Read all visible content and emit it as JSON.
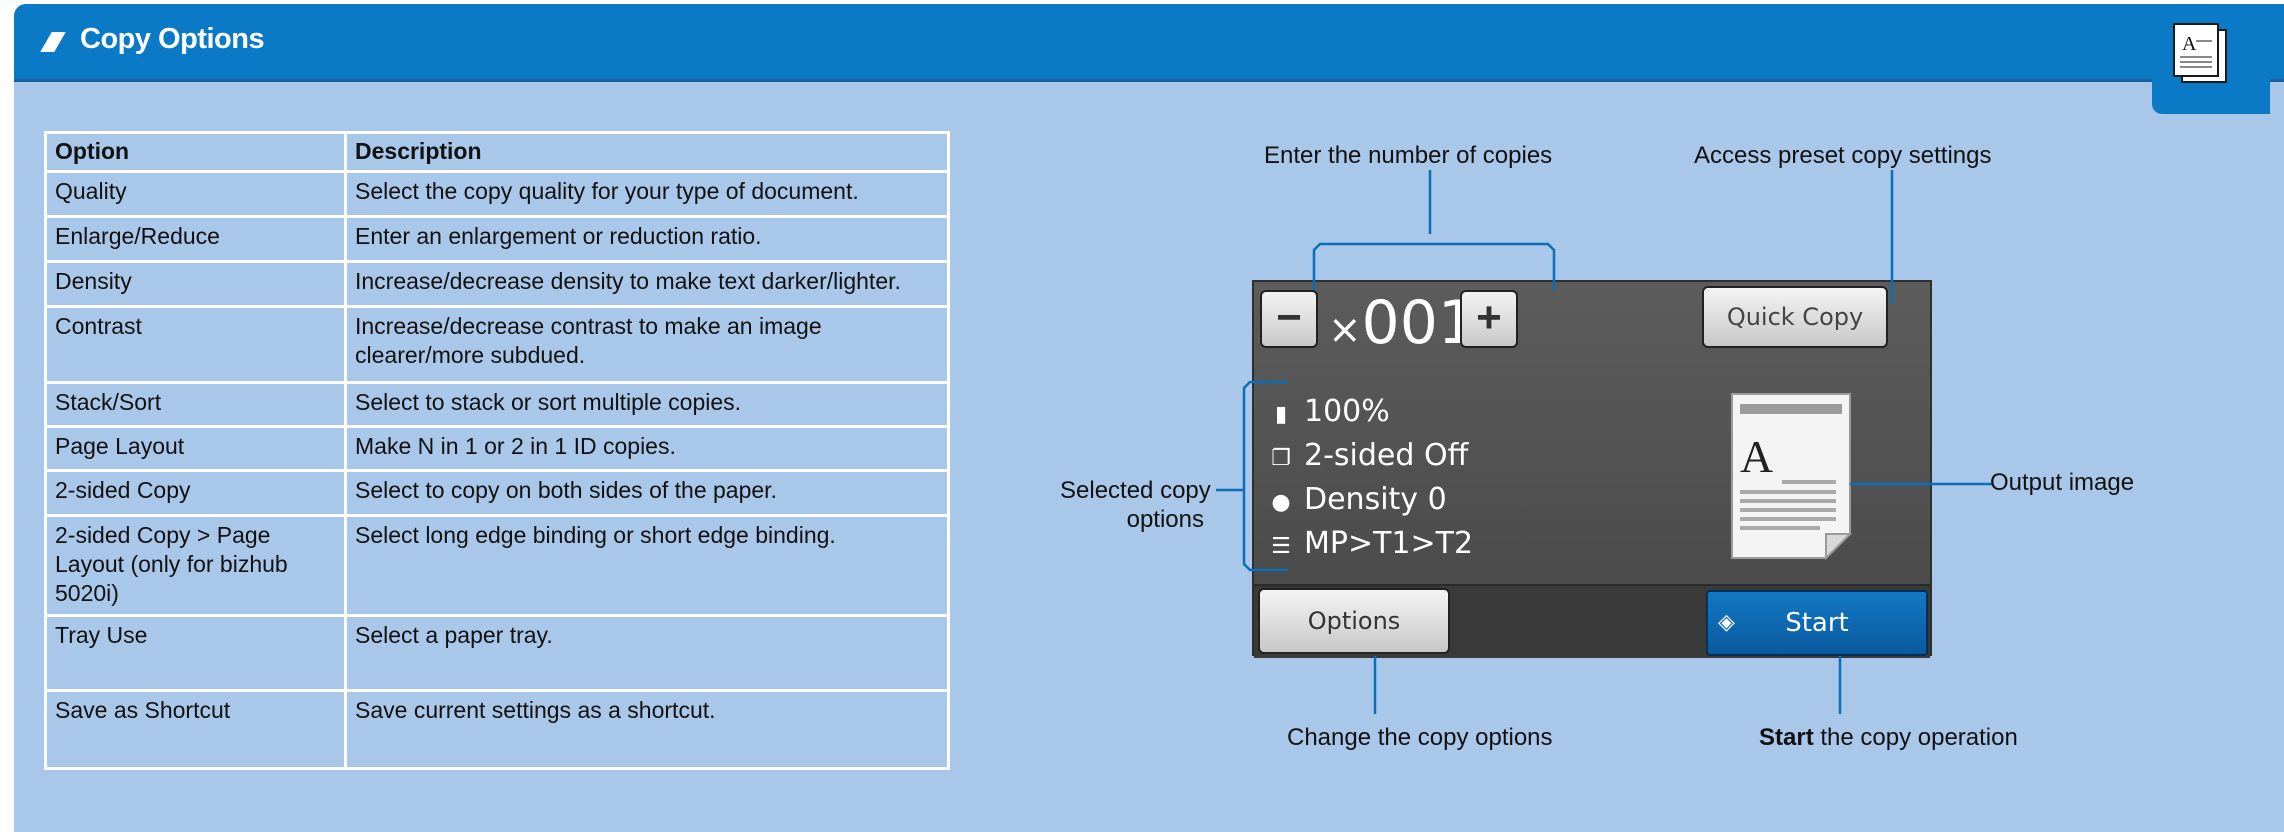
{
  "header": {
    "title": "Copy Options",
    "pencil_icon": "pencil-icon",
    "section_icon": "copy-document-icon",
    "section_icon_letter": "A"
  },
  "table": {
    "headers": [
      "Option",
      "Description"
    ],
    "rows": [
      [
        "Quality",
        "Select the copy quality for your type of document."
      ],
      [
        "Enlarge/Reduce",
        "Enter an enlargement or reduction ratio."
      ],
      [
        "Density",
        "Increase/decrease density to make text darker/lighter."
      ],
      [
        "Contrast",
        "Increase/decrease contrast to make an image clearer/more subdued."
      ],
      [
        "Stack/Sort",
        "Select to stack or sort multiple copies."
      ],
      [
        "Page Layout",
        "Make N in 1 or 2 in 1 ID copies."
      ],
      [
        "2-sided Copy",
        "Select to copy on both sides of the paper."
      ],
      [
        "2-sided Copy > Page Layout (only for bizhub 5020i)",
        "Select long edge binding or short edge binding."
      ],
      [
        "Tray Use",
        "Select a paper tray."
      ],
      [
        "Save as Shortcut",
        "Save current settings as a shortcut."
      ]
    ]
  },
  "screen": {
    "minus_label": "−",
    "plus_label": "+",
    "copies_prefix": "×",
    "copies_value": "001",
    "quick_copy_label": "Quick Copy",
    "options_label": "Options",
    "start_label": "Start",
    "output_letter": "A",
    "selected_options": [
      {
        "icon": "page-icon",
        "glyph": "▮",
        "text": "100%"
      },
      {
        "icon": "duplex-icon",
        "glyph": "❐",
        "text": "2-sided Off"
      },
      {
        "icon": "drop-icon",
        "glyph": "●",
        "text": "Density 0"
      },
      {
        "icon": "list-icon",
        "glyph": "☰",
        "text": "MP>T1>T2"
      }
    ]
  },
  "callouts": {
    "enter_copies": "Enter the number of copies",
    "access_preset": "Access preset copy settings",
    "selected_options_line1": "Selected copy",
    "selected_options_line2": "options",
    "output_image": "Output image",
    "change_options": "Change the copy options",
    "start_bold": "Start",
    "start_rest": " the copy operation"
  },
  "colors": {
    "header_blue": "#0a7ac7",
    "panel_blue": "#a9c7e9",
    "callout_line": "#0a6fb8",
    "start_button": "#0a6ab4"
  }
}
